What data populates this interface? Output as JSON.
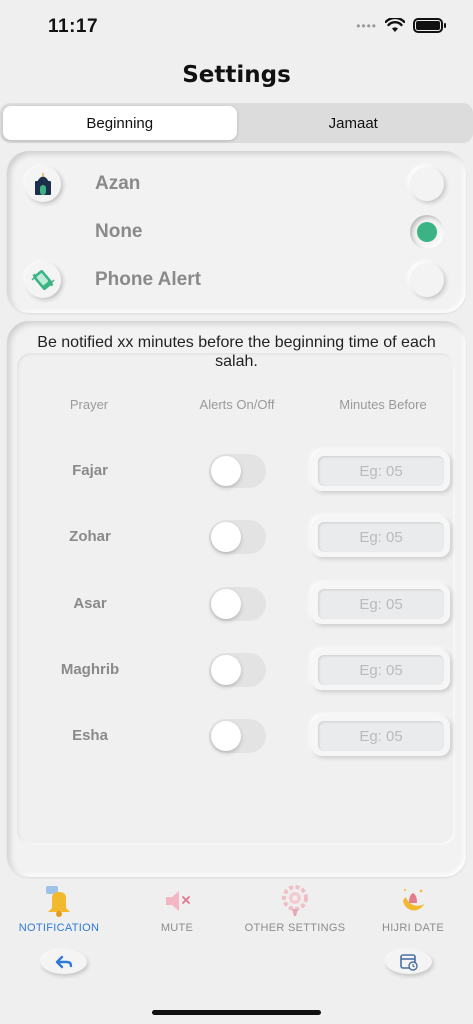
{
  "status_bar": {
    "time": "11:17",
    "signal_icon": "dots-icon",
    "wifi_icon": "wifi-icon",
    "battery_icon": "battery-icon"
  },
  "header": {
    "title": "Settings"
  },
  "segments": [
    {
      "label": "Beginning",
      "active": true
    },
    {
      "label": "Jamaat",
      "active": false
    }
  ],
  "alert_options": [
    {
      "label": "Azan",
      "icon": "mosque-icon",
      "selected": false
    },
    {
      "label": "None",
      "icon": "",
      "selected": true
    },
    {
      "label": "Phone Alert",
      "icon": "phone-vibrate-icon",
      "selected": false
    }
  ],
  "minutes_panel": {
    "notice": "Be notified xx minutes before the beginning time of each salah.",
    "headers": {
      "prayer": "Prayer",
      "alerts": "Alerts On/Off",
      "minutes": "Minutes Before"
    },
    "rows": [
      {
        "prayer": "Fajar",
        "alert_on": false,
        "placeholder": "Eg: 05"
      },
      {
        "prayer": "Zohar",
        "alert_on": false,
        "placeholder": "Eg: 05"
      },
      {
        "prayer": "Asar",
        "alert_on": false,
        "placeholder": "Eg: 05"
      },
      {
        "prayer": "Maghrib",
        "alert_on": false,
        "placeholder": "Eg: 05"
      },
      {
        "prayer": "Esha",
        "alert_on": false,
        "placeholder": "Eg: 05"
      }
    ]
  },
  "tabbar": [
    {
      "label": "NOTIFICATION",
      "icon": "bell-icon",
      "active": true
    },
    {
      "label": "MUTE",
      "icon": "mute-icon",
      "active": false
    },
    {
      "label": "OTHER SETTINGS",
      "icon": "settings-icon",
      "active": false
    },
    {
      "label": "HIJRI DATE",
      "icon": "crescent-icon",
      "active": false
    }
  ],
  "bottom_buttons": {
    "back_icon": "back-arrow-icon",
    "calendar_icon": "calendar-icon"
  },
  "colors": {
    "accent_green": "#3cb384",
    "active_tab_blue": "#2f7ad6",
    "background": "#efefef"
  }
}
